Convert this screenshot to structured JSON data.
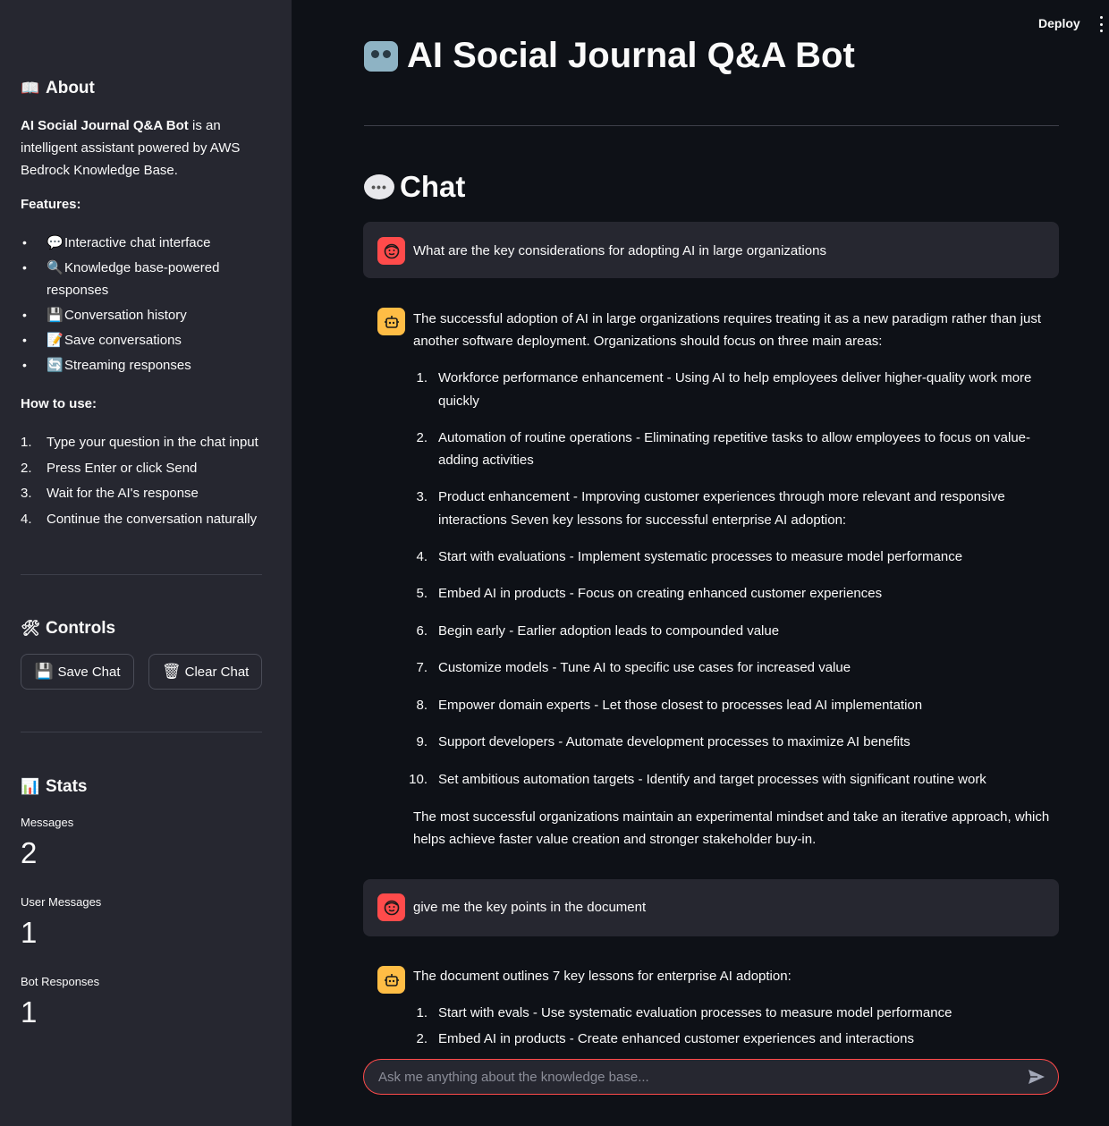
{
  "sidebar": {
    "about": {
      "icon": "📖",
      "title": "About",
      "app_name": "AI Social Journal Q&A Bot",
      "description": " is an intelligent assistant powered by AWS Bedrock Knowledge Base."
    },
    "features": {
      "title": "Features:",
      "items": [
        {
          "icon": "💬",
          "label": "Interactive chat interface"
        },
        {
          "icon": "🔍",
          "label": "Knowledge base-powered responses"
        },
        {
          "icon": "💾",
          "label": "Conversation history"
        },
        {
          "icon": "📝",
          "label": "Save conversations"
        },
        {
          "icon": "🔄",
          "label": "Streaming responses"
        }
      ]
    },
    "howto": {
      "title": "How to use:",
      "items": [
        {
          "num": "1.",
          "label": "Type your question in the chat input"
        },
        {
          "num": "2.",
          "label": "Press Enter or click Send"
        },
        {
          "num": "3.",
          "label": "Wait for the AI's response"
        },
        {
          "num": "4.",
          "label": "Continue the conversation naturally"
        }
      ]
    },
    "controls": {
      "icon": "🛠",
      "title": "Controls",
      "save_icon": "💾",
      "save_label": "Save Chat",
      "clear_icon": "🗑",
      "clear_label": "Clear Chat"
    },
    "stats": {
      "icon": "📊",
      "title": "Stats",
      "metrics": [
        {
          "label": "Messages",
          "value": "2"
        },
        {
          "label": "User Messages",
          "value": "1"
        },
        {
          "label": "Bot Responses",
          "value": "1"
        }
      ]
    }
  },
  "header": {
    "deploy_label": "Deploy"
  },
  "main": {
    "title": "AI Social Journal Q&A Bot",
    "chat_title": "Chat",
    "messages": [
      {
        "role": "user",
        "text": "What are the key considerations for adopting AI in large organizations"
      },
      {
        "role": "assistant",
        "intro": "The successful adoption of AI in large organizations requires treating it as a new paradigm rather than just another software deployment. Organizations should focus on three main areas:",
        "items": [
          {
            "num": "1.",
            "text": "Workforce performance enhancement - Using AI to help employees deliver higher-quality work more quickly"
          },
          {
            "num": "2.",
            "text": "Automation of routine operations - Eliminating repetitive tasks to allow employees to focus on value-adding activities"
          },
          {
            "num": "3.",
            "text": "Product enhancement - Improving customer experiences through more relevant and responsive interactions Seven key lessons for successful enterprise AI adoption:"
          },
          {
            "num": "4.",
            "text": "Start with evaluations - Implement systematic processes to measure model performance"
          },
          {
            "num": "5.",
            "text": "Embed AI in products - Focus on creating enhanced customer experiences"
          },
          {
            "num": "6.",
            "text": "Begin early - Earlier adoption leads to compounded value"
          },
          {
            "num": "7.",
            "text": "Customize models - Tune AI to specific use cases for increased value"
          },
          {
            "num": "8.",
            "text": "Empower domain experts - Let those closest to processes lead AI implementation"
          },
          {
            "num": "9.",
            "text": "Support developers - Automate development processes to maximize AI benefits"
          },
          {
            "num": "10.",
            "text": "Set ambitious automation targets - Identify and target processes with significant routine work"
          }
        ],
        "outro": "The most successful organizations maintain an experimental mindset and take an iterative approach, which helps achieve faster value creation and stronger stakeholder buy-in."
      },
      {
        "role": "user",
        "text": "give me the key points in the document"
      },
      {
        "role": "assistant",
        "intro": "The document outlines 7 key lessons for enterprise AI adoption:",
        "items": [
          {
            "num": "1.",
            "text": "Start with evals - Use systematic evaluation processes to measure model performance"
          },
          {
            "num": "2.",
            "text": "Embed AI in products - Create enhanced customer experiences and interactions"
          }
        ]
      }
    ]
  },
  "chat_input": {
    "placeholder": "Ask me anything about the knowledge base..."
  },
  "colors": {
    "background": "#0e1117",
    "sidebar": "#262730",
    "user_avatar": "#ff4b4b",
    "bot_avatar": "#ffbd45",
    "input_border": "#ff4b4b"
  },
  "icons": {
    "title": "robot-face-icon",
    "chat": "speech-balloon-icon",
    "user_avatar": "user-face-icon",
    "bot_avatar": "robot-icon",
    "send": "send-arrow-icon",
    "menu": "kebab-menu-icon"
  }
}
